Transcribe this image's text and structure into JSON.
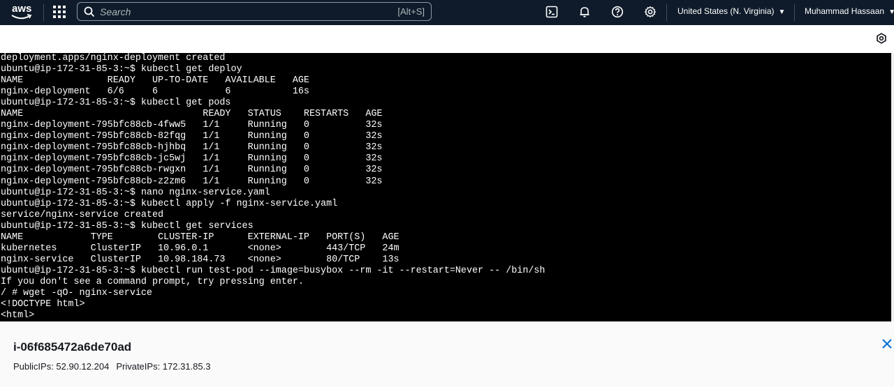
{
  "topbar": {
    "logo_text": "aws",
    "search_placeholder": "Search",
    "search_shortcut": "[Alt+S]",
    "icons": [
      "apps-grid-icon",
      "cloudshell-icon",
      "bell-icon",
      "help-icon",
      "gear-icon"
    ],
    "region": "United States (N. Virginia)",
    "user": "Muhammad Hassaan",
    "colors": {
      "bar": "#0f1b2a",
      "text": "#ffffff"
    }
  },
  "terminal": {
    "lines": [
      "deployment.apps/nginx-deployment created",
      "ubuntu@ip-172-31-85-3:~$ kubectl get deploy",
      "NAME               READY   UP-TO-DATE   AVAILABLE   AGE",
      "nginx-deployment   6/6     6            6           16s",
      "ubuntu@ip-172-31-85-3:~$ kubectl get pods",
      "NAME                                READY   STATUS    RESTARTS   AGE",
      "nginx-deployment-795bfc88cb-4fww5   1/1     Running   0          32s",
      "nginx-deployment-795bfc88cb-82fqg   1/1     Running   0          32s",
      "nginx-deployment-795bfc88cb-hjhbq   1/1     Running   0          32s",
      "nginx-deployment-795bfc88cb-jc5wj   1/1     Running   0          32s",
      "nginx-deployment-795bfc88cb-rwgxn   1/1     Running   0          32s",
      "nginx-deployment-795bfc88cb-z2zm6   1/1     Running   0          32s",
      "ubuntu@ip-172-31-85-3:~$ nano nginx-service.yaml",
      "ubuntu@ip-172-31-85-3:~$ kubectl apply -f nginx-service.yaml",
      "service/nginx-service created",
      "ubuntu@ip-172-31-85-3:~$ kubectl get services",
      "NAME            TYPE        CLUSTER-IP      EXTERNAL-IP   PORT(S)   AGE",
      "kubernetes      ClusterIP   10.96.0.1       <none>        443/TCP   24m",
      "nginx-service   ClusterIP   10.98.184.73    <none>        80/TCP    13s",
      "ubuntu@ip-172-31-85-3:~$ kubectl run test-pod --image=busybox --rm -it --restart=Never -- /bin/sh",
      "If you don't see a command prompt, try pressing enter.",
      "/ # wget -qO- nginx-service",
      "<!DOCTYPE html>",
      "<html>"
    ],
    "colors": {
      "background": "#000000",
      "text": "#ffffff"
    }
  },
  "instance": {
    "id": "i-06f685472a6de70ad",
    "public_ips": "PublicIPs: 52.90.12.204",
    "private_ips": "PrivateIPs: 172.31.85.3"
  }
}
